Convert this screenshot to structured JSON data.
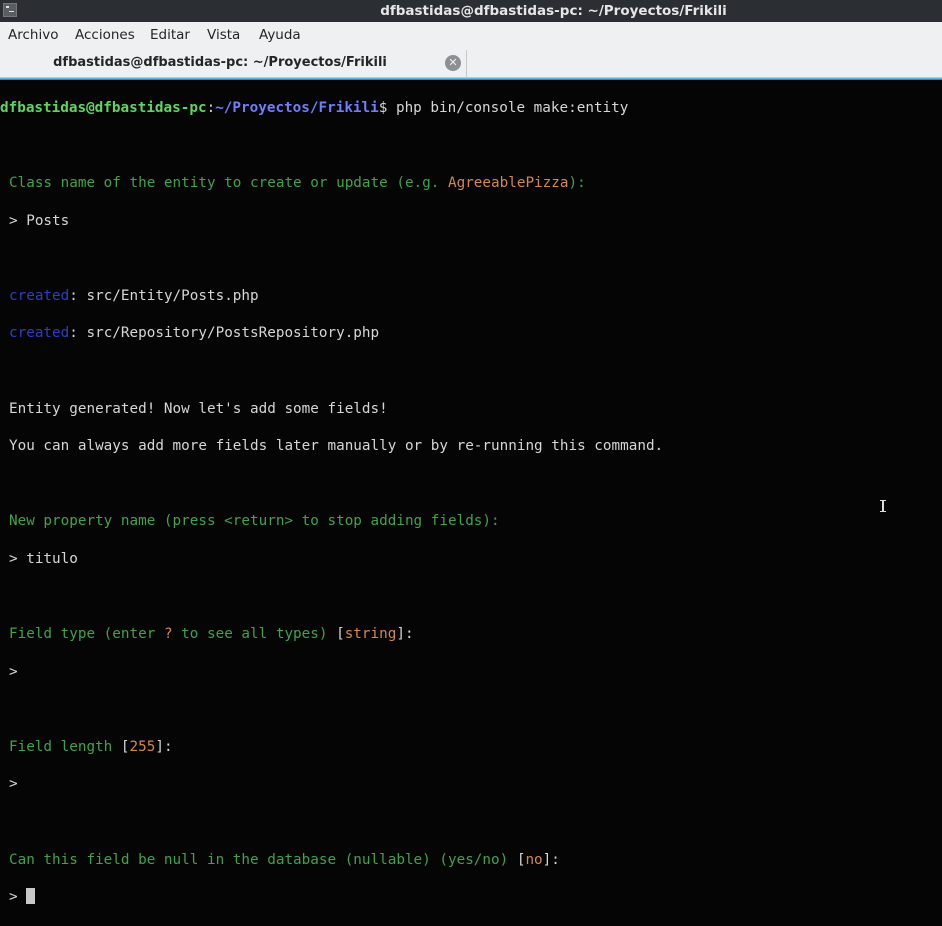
{
  "window": {
    "title": "dfbastidas@dfbastidas-pc: ~/Proyectos/Frikili",
    "icon": "terminal-icon"
  },
  "menu": [
    "Archivo",
    "Acciones",
    "Editar",
    "Vista",
    "Ayuda"
  ],
  "tabs": [
    {
      "label": "dfbastidas@dfbastidas-pc: ~/Proyectos/Frikili",
      "close_icon": "close-icon",
      "active": true
    }
  ],
  "colors": {
    "prompt_user": "#5fd75f",
    "prompt_path": "#6f7dff",
    "question": "#3fa34a",
    "default_value": "#d4884a",
    "created": "#2b3fc2",
    "accent": "#3daee9"
  },
  "terminal": {
    "prompt_user": "dfbastidas@dfbastidas-pc",
    "prompt_sep": ":",
    "prompt_path": "~/Proyectos/Frikili",
    "prompt_symbol": "$",
    "command": " php bin/console make:entity",
    "q1_text": "Class name of the entity to create or update (e.g. ",
    "q1_example": "AgreeablePizza",
    "q1_end": "):",
    "a1": "> Posts",
    "created_label": "created",
    "created_files": [
      ": src/Entity/Posts.php",
      ": src/Repository/PostsRepository.php"
    ],
    "msg1": "Entity generated! Now let's add some fields!",
    "msg2": "You can always add more fields later manually or by re-running this command.",
    "q2": "New property name (press <return> to stop adding fields):",
    "a2": "> titulo",
    "q3_text": "Field type (enter ",
    "q3_q": "?",
    "q3_mid": " to see all types) ",
    "q3_default": "string",
    "a3": ">",
    "q4_text": "Field length ",
    "q4_default": "255",
    "a4": ">",
    "q5_text": "Can this field be null in the database (nullable) (yes/no) ",
    "q5_default": "no",
    "a5": "> ",
    "bracket_open": "[",
    "bracket_close": "]",
    "colon": ":"
  }
}
